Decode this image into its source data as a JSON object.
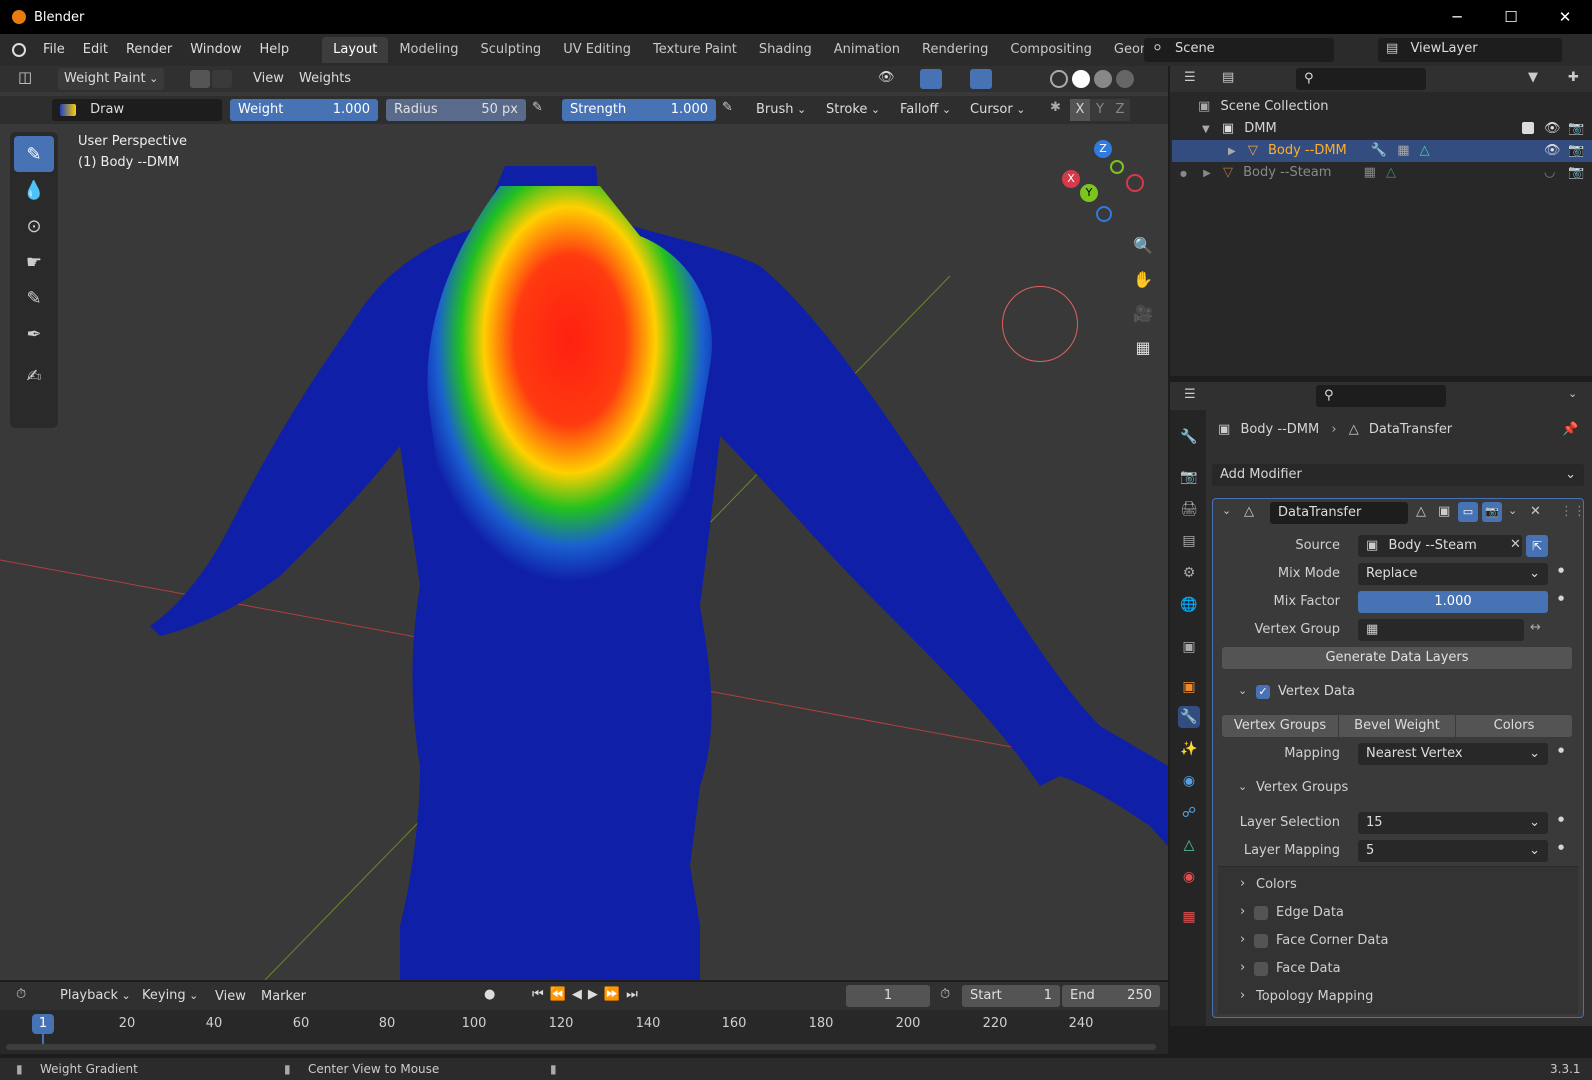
{
  "app": {
    "title": "Blender",
    "version": "3.3.1"
  },
  "window_controls": {
    "minimize": "─",
    "maximize": "☐",
    "close": "✕"
  },
  "menu": [
    "File",
    "Edit",
    "Render",
    "Window",
    "Help"
  ],
  "workspaces": [
    "Layout",
    "Modeling",
    "Sculpting",
    "UV Editing",
    "Texture Paint",
    "Shading",
    "Animation",
    "Rendering",
    "Compositing",
    "Geometry"
  ],
  "active_workspace": "Layout",
  "scene": {
    "name": "Scene",
    "view_layer": "ViewLayer"
  },
  "viewport_header": {
    "mode": "Weight Paint",
    "view": "View",
    "weights": "Weights"
  },
  "tool_settings": {
    "tool": "Draw",
    "weight_label": "Weight",
    "weight_value": "1.000",
    "radius_label": "Radius",
    "radius_value": "50 px",
    "strength_label": "Strength",
    "strength_value": "1.000",
    "brush": "Brush",
    "stroke": "Stroke",
    "falloff": "Falloff",
    "cursor": "Cursor",
    "axes": [
      "X",
      "Y",
      "Z"
    ]
  },
  "viewport": {
    "perspective": "User Perspective",
    "object": "(1) Body --DMM"
  },
  "gizmo": {
    "z": "Z",
    "x": "X",
    "y": "Y"
  },
  "outliner": {
    "root": "Scene Collection",
    "collection": "DMM",
    "items": [
      "Body --DMM",
      "Body --Steam"
    ]
  },
  "properties": {
    "breadcrumb_object": "Body --DMM",
    "breadcrumb_modifier": "DataTransfer",
    "add_modifier": "Add Modifier",
    "modifier_name": "DataTransfer",
    "source_label": "Source",
    "source_value": "Body --Steam",
    "mix_mode_label": "Mix Mode",
    "mix_mode_value": "Replace",
    "mix_factor_label": "Mix Factor",
    "mix_factor_value": "1.000",
    "vertex_group_label": "Vertex Group",
    "generate_button": "Generate Data Layers",
    "vertex_data_label": "Vertex Data",
    "vertex_tabs": [
      "Vertex Groups",
      "Bevel Weight",
      "Colors"
    ],
    "mapping_label": "Mapping",
    "mapping_value": "Nearest Vertex",
    "vertex_groups_sub": "Vertex Groups",
    "layer_selection_label": "Layer Selection",
    "layer_selection_value": "15",
    "layer_mapping_label": "Layer Mapping",
    "layer_mapping_value": "5",
    "colors_sub": "Colors",
    "edge_data": "Edge Data",
    "face_corner_data": "Face Corner Data",
    "face_data": "Face Data",
    "topology_mapping": "Topology Mapping"
  },
  "timeline": {
    "playback": "Playback",
    "keying": "Keying",
    "view": "View",
    "marker": "Marker",
    "current_frame": "1",
    "start_label": "Start",
    "start_value": "1",
    "end_label": "End",
    "end_value": "250",
    "ticks": [
      "1",
      "20",
      "40",
      "60",
      "80",
      "100",
      "120",
      "140",
      "160",
      "180",
      "200",
      "220",
      "240"
    ]
  },
  "statusbar": {
    "left": "Weight Gradient",
    "middle": "Center View to Mouse"
  }
}
